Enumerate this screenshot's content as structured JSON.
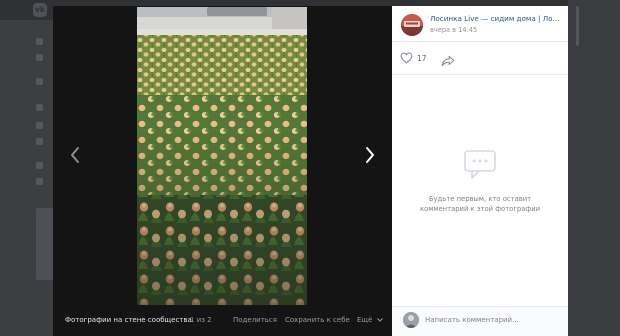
{
  "viewer": {
    "album_label": "Фотографии на стене сообщества",
    "counter": "1 из 2",
    "share_label": "Поделиться",
    "save_label": "Сохранить к себе",
    "more_label": "Ещё"
  },
  "post": {
    "group_name": "Лосинка Live — сидим дома | Лоси...",
    "time": "вчера в 14:45",
    "likes": "17"
  },
  "comments": {
    "empty_line1": "Будьте первым, кто оставит",
    "empty_line2": "комментарий к этой фотографии",
    "placeholder": "Написать комментарий..."
  },
  "colors": {
    "link": "#2a5885",
    "overlay": "#4a4b4e",
    "viewer_bg": "#141414",
    "panel_bg": "#ffffff"
  },
  "icons": [
    "vk-logo-icon",
    "chevron-left-icon",
    "chevron-right-icon",
    "heart-icon",
    "share-icon",
    "comments-empty-icon",
    "chevron-down-icon"
  ]
}
